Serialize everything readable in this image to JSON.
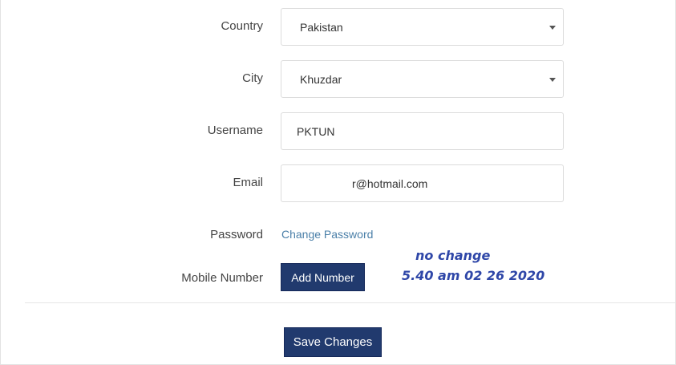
{
  "form": {
    "country": {
      "label": "Country",
      "value": "Pakistan"
    },
    "city": {
      "label": "City",
      "value": "Khuzdar"
    },
    "username": {
      "label": "Username",
      "value": "PKTUN"
    },
    "email": {
      "label": "Email",
      "value": "r@hotmail.com"
    },
    "password": {
      "label": "Password",
      "link_text": "Change Password"
    },
    "mobile": {
      "label": "Mobile Number",
      "button_label": "Add Number"
    },
    "save_label": "Save Changes"
  },
  "annotation": {
    "line1": "no change",
    "line2": "5.40 am 02 26 2020"
  },
  "icons": {
    "select_caret": "caret-down-icon"
  },
  "colors": {
    "button_bg": "#213a6e",
    "link": "#4a7fa8",
    "annotation": "#2f47a8"
  }
}
